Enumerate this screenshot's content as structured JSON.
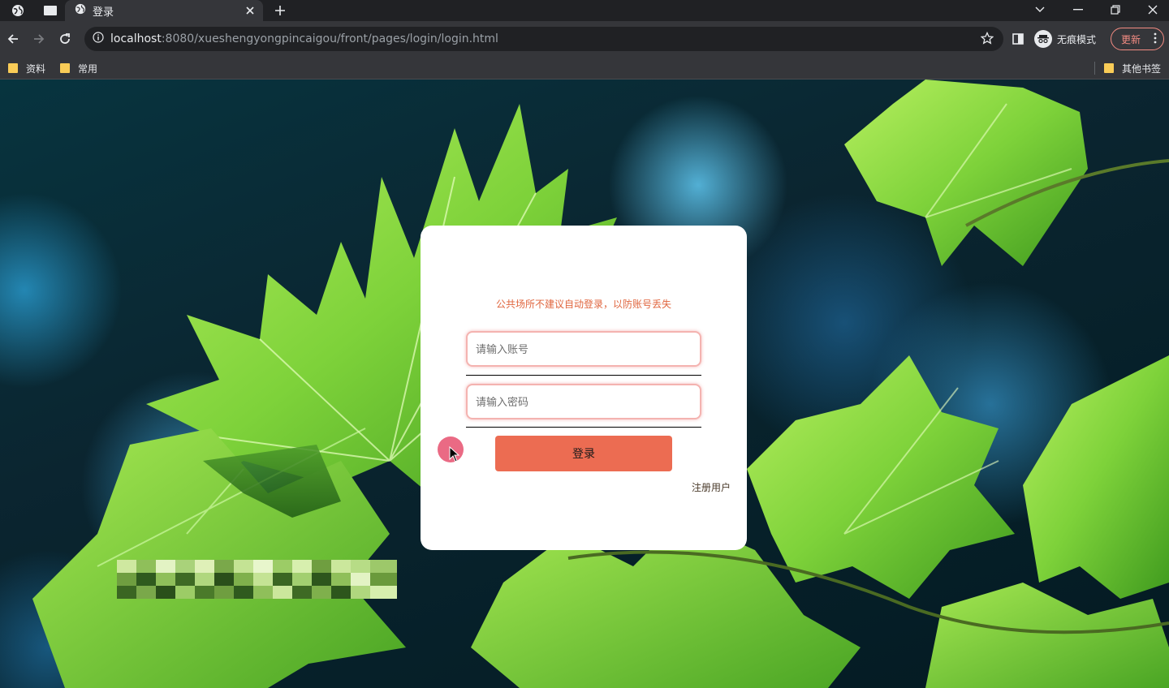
{
  "browser": {
    "tab_title": "登录",
    "url_host": "localhost",
    "url_rest": ":8080/xueshengyongpincaigou/front/pages/login/login.html",
    "incognito_label": "无痕模式",
    "update_label": "更新",
    "bookmarks": [
      {
        "label": "资料"
      },
      {
        "label": "常用"
      }
    ],
    "other_bookmarks": "其他书签"
  },
  "login": {
    "notice": "公共场所不建议自动登录，以防账号丢失",
    "username_placeholder": "请输入账号",
    "password_placeholder": "请输入密码",
    "submit_label": "登录",
    "register_label": "注册用户"
  },
  "colors": {
    "accent": "#ec6c52",
    "notice": "#e0663f",
    "field_border": "#f4b3b0"
  }
}
